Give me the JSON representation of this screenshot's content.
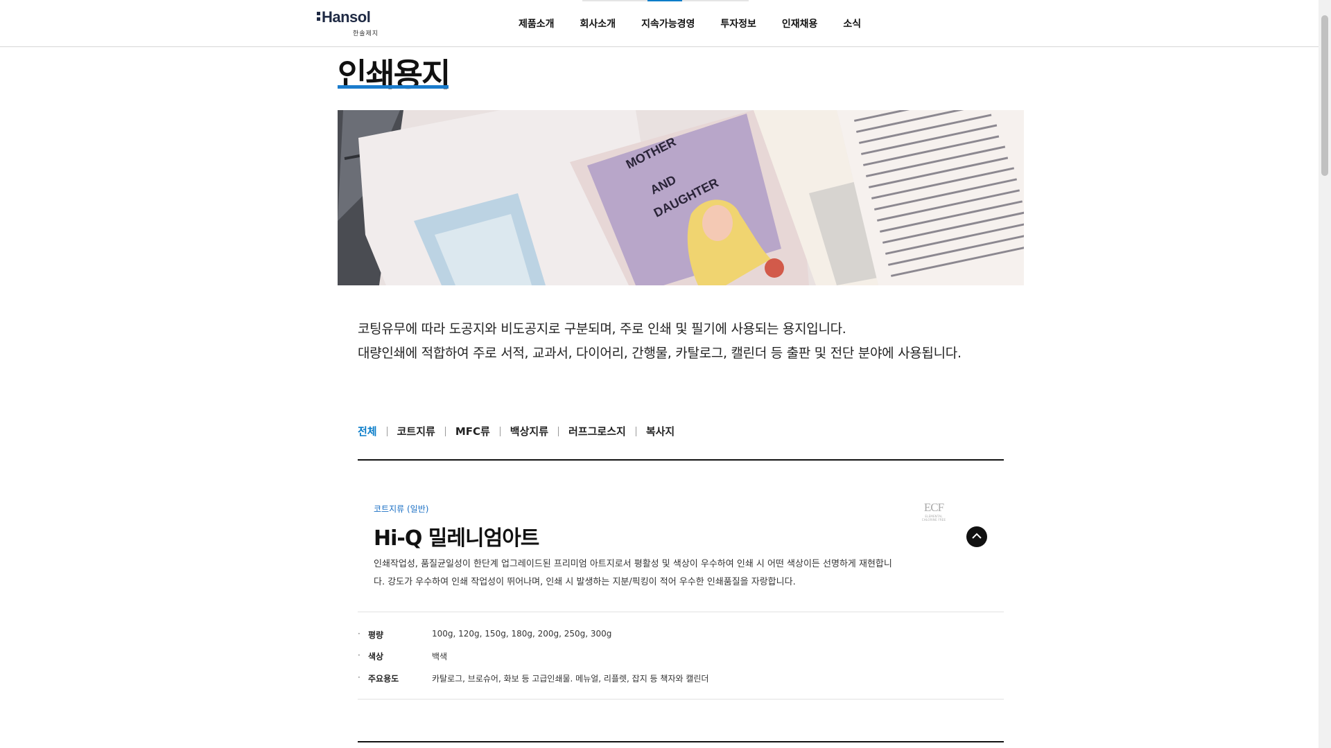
{
  "header": {
    "logo_text": "Hansol",
    "logo_sub": "한솔제지",
    "nav": [
      "제품소개",
      "회사소개",
      "지속가능경영",
      "투자정보",
      "인재채용",
      "소식"
    ]
  },
  "page": {
    "title": "인쇄용지",
    "description": [
      "코팅유무에 따라 도공지와 비도공지로 구분되며, 주로 인쇄 및 필기에 사용되는 용지입니다.",
      "대량인쇄에 적합하여 주로 서적, 교과서, 다이어리, 간행물, 카탈로그, 캘린더 등 출판 및 전단 분야에 사용됩니다."
    ]
  },
  "banner": {
    "book_title": [
      "MOTHER",
      "AND",
      "DAUGHTER"
    ]
  },
  "tabs": [
    "전체",
    "코트지류",
    "MFC류",
    "백상지류",
    "러프그로스지",
    "복사지"
  ],
  "product": {
    "category": "코트지류 (일반)",
    "name": "Hi-Q 밀레니엄아트",
    "description": [
      "인쇄작업성, 품질균일성이 한단계 업그레이드된 프리미엄 아트지로서 평활성 및 색상이 우수하여 인쇄 시 어떤 색상이든 선명하게 재현합니",
      "다. 강도가 우수하여 인쇄 작업성이 뛰어나며, 인쇄 시 발생하는 지분/픽킹이 적어 우수한 인쇄품질을 자랑합니다."
    ],
    "badge": "ECF",
    "badge_sub": [
      "ELEMENTAL",
      "CHLORINE FREE"
    ],
    "specs": [
      {
        "bullet": "·",
        "label": "평량",
        "value": "100g, 120g, 150g, 180g, 200g, 250g, 300g"
      },
      {
        "bullet": "·",
        "label": "색상",
        "value": "백색"
      },
      {
        "bullet": "·",
        "label": "주요용도",
        "value": "카탈로그, 브로슈어, 화보 등 고급인쇄물. 메뉴얼, 리플렛, 잡지 등 책자와 캘린더"
      }
    ]
  },
  "colors": {
    "accent": "#0a7dc9",
    "title_underline": "#1a7ccc",
    "logo": "#1f2a44"
  }
}
